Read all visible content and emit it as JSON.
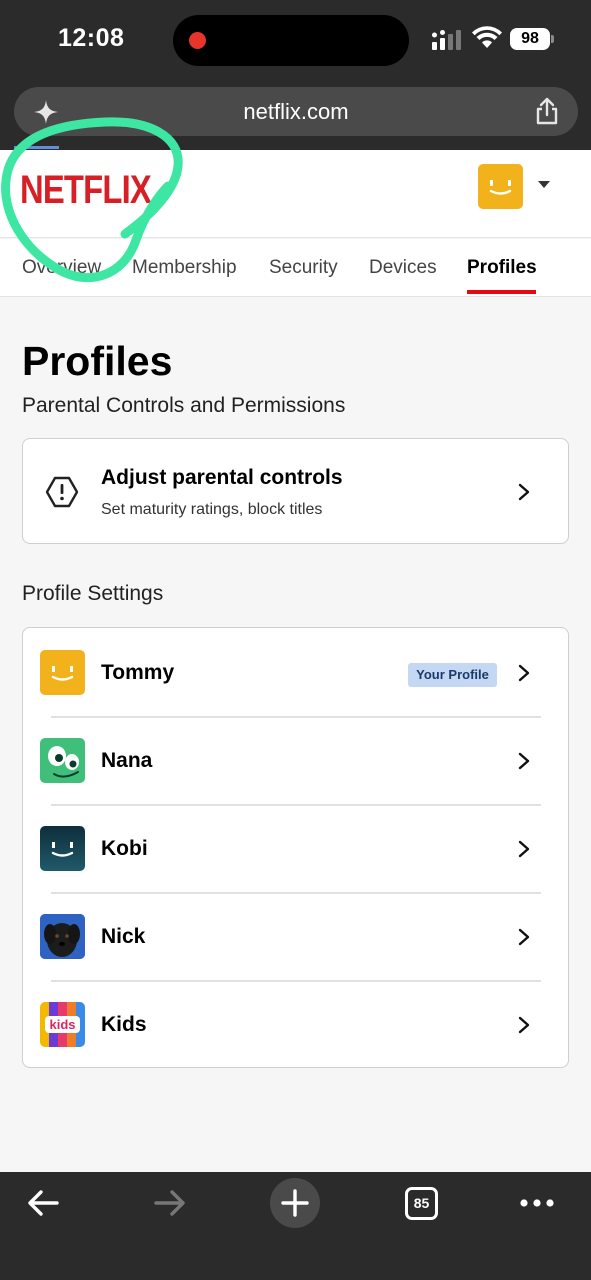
{
  "status_bar": {
    "time": "12:08",
    "battery": "98"
  },
  "browser": {
    "url": "netflix.com",
    "tab_count": "85"
  },
  "header": {
    "logo": "NETFLIX"
  },
  "tabs": [
    {
      "label": "Overview"
    },
    {
      "label": "Membership"
    },
    {
      "label": "Security"
    },
    {
      "label": "Devices"
    },
    {
      "label": "Profiles",
      "active": true
    }
  ],
  "page": {
    "title": "Profiles",
    "subtitle": "Parental Controls and Permissions"
  },
  "parental": {
    "title": "Adjust parental controls",
    "subtitle": "Set maturity ratings, block titles"
  },
  "profile_settings": {
    "label": "Profile Settings",
    "badge": "Your Profile",
    "profiles": [
      {
        "name": "Tommy",
        "avatar": "yellow-smile-avatar"
      },
      {
        "name": "Nana",
        "avatar": "green-creature-avatar"
      },
      {
        "name": "Kobi",
        "avatar": "teal-smile-avatar"
      },
      {
        "name": "Nick",
        "avatar": "dog-photo-avatar"
      },
      {
        "name": "Kids",
        "avatar": "kids-avatar"
      }
    ]
  },
  "colors": {
    "netflix_red": "#e50914",
    "annotation_green": "#3de6a3",
    "badge_bg": "#c4d8f3"
  }
}
